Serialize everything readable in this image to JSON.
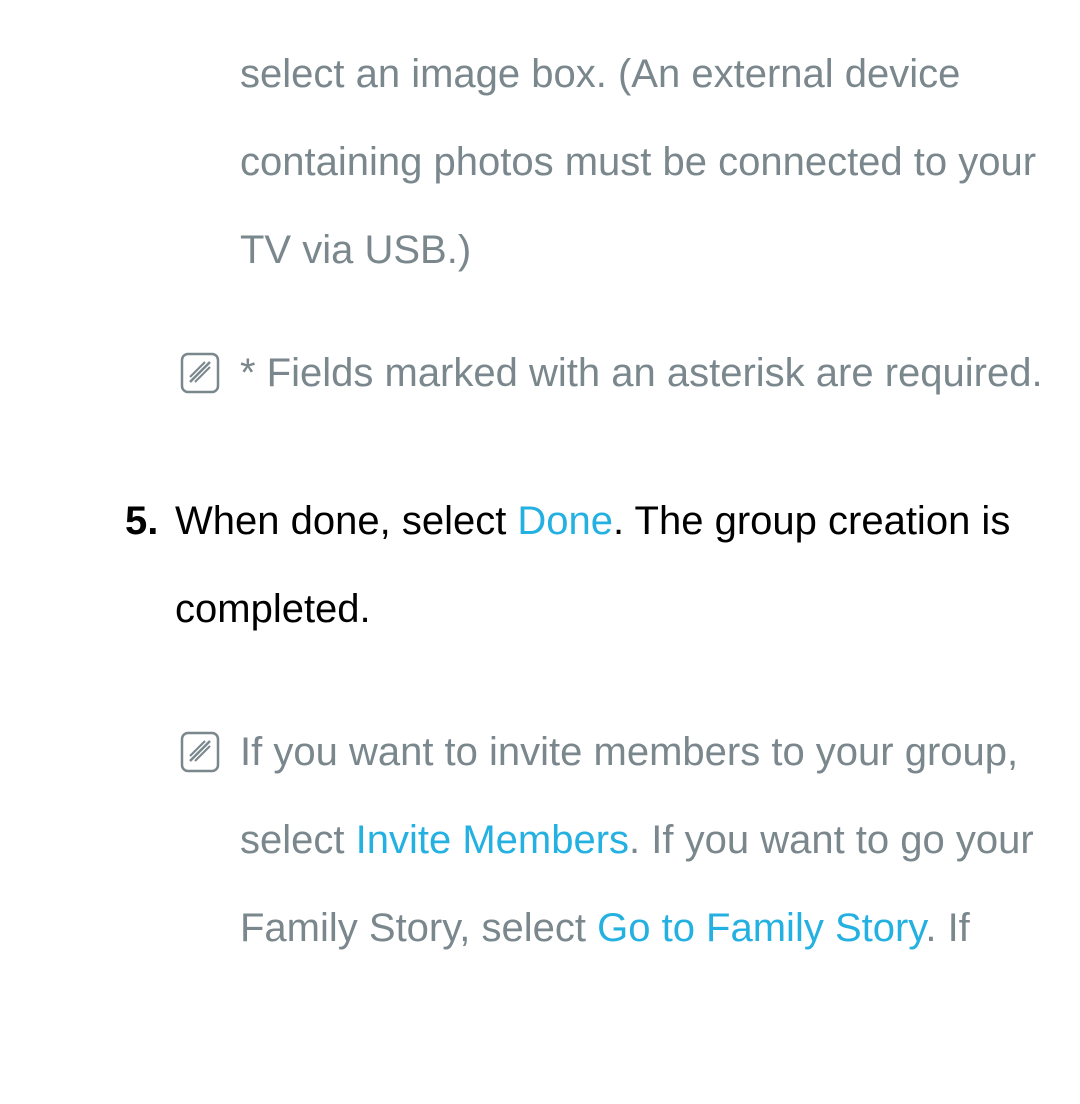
{
  "truncated_top": "select an image box. (An external device containing photos must be connected to your TV via USB.)",
  "note1": "* Fields marked with an asterisk are required.",
  "step5": {
    "number": "5.",
    "part1": "When done, select ",
    "done": "Done",
    "part2": ". The group creation is completed."
  },
  "note2": {
    "part1": "If you want to invite members to your group, select ",
    "invite_members": "Invite Members",
    "part2": ". If you want to go your Family Story, select ",
    "go_to_family_story": "Go to Family Story",
    "part3": ". If"
  }
}
